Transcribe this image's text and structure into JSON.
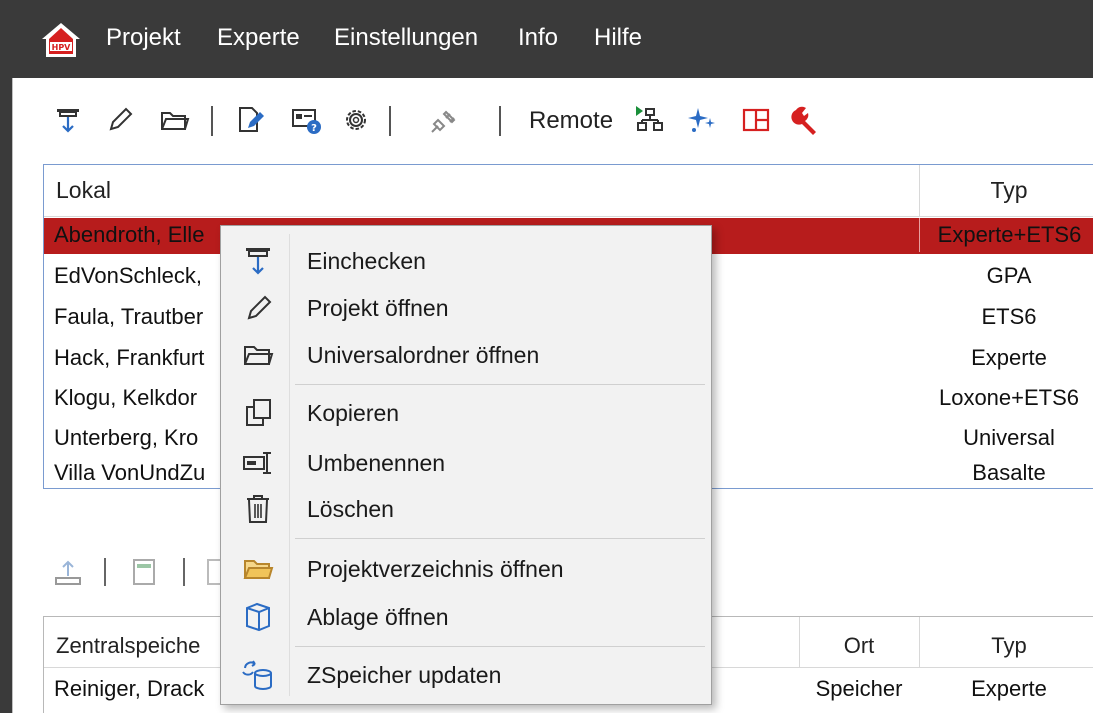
{
  "menubar": {
    "items": [
      "Projekt",
      "Experte",
      "Einstellungen",
      "Info",
      "Hilfe"
    ]
  },
  "toolbar": {
    "remote_label": "Remote",
    "icons": [
      "checkin-icon",
      "pencil-icon",
      "folder-icon",
      "edit-doc-icon",
      "info-card-icon",
      "gear-icon",
      "plug-icon",
      "network-icon",
      "sparkle-icon",
      "layout-icon",
      "wrench-icon"
    ]
  },
  "local_table": {
    "headers": {
      "name": "Lokal",
      "type": "Typ"
    },
    "rows": [
      {
        "name": "Abendroth, Elle",
        "type": "Experte+ETS6",
        "selected": true
      },
      {
        "name": "EdVonSchleck,",
        "type": "GPA"
      },
      {
        "name": "Faula, Trautber",
        "type": "ETS6"
      },
      {
        "name": "Hack, Frankfurt",
        "type": "Experte"
      },
      {
        "name": "Klogu, Kelkdor",
        "type": "Loxone+ETS6"
      },
      {
        "name": "Unterberg, Kro",
        "type": "Universal"
      },
      {
        "name": "Villa VonUndZu",
        "type": "Basalte"
      }
    ]
  },
  "central_table": {
    "headers": {
      "name": "Zentralspeiche",
      "location": "Ort",
      "type": "Typ"
    },
    "rows": [
      {
        "name": "Reiniger, Drack",
        "location": "Speicher",
        "type": "Experte"
      }
    ]
  },
  "context_menu": {
    "items": [
      {
        "label": "Einchecken",
        "icon": "checkin-icon"
      },
      {
        "label": "Projekt öffnen",
        "icon": "pencil-icon"
      },
      {
        "label": "Universalordner öffnen",
        "icon": "folder-icon"
      },
      {
        "label": "Kopieren",
        "icon": "copy-icon"
      },
      {
        "label": "Umbenennen",
        "icon": "rename-icon"
      },
      {
        "label": "Löschen",
        "icon": "trash-icon"
      },
      {
        "label": "Projektverzeichnis öffnen",
        "icon": "folder-yellow-icon"
      },
      {
        "label": "Ablage öffnen",
        "icon": "cylinder-icon"
      },
      {
        "label": "ZSpeicher updaten",
        "icon": "sync-storage-icon"
      }
    ]
  },
  "colors": {
    "menubar": "#3a3a3a",
    "selection": "#b71c1c",
    "accent_blue": "#2b6cc4",
    "accent_red": "#d62020",
    "accent_green": "#1a8f3a"
  }
}
